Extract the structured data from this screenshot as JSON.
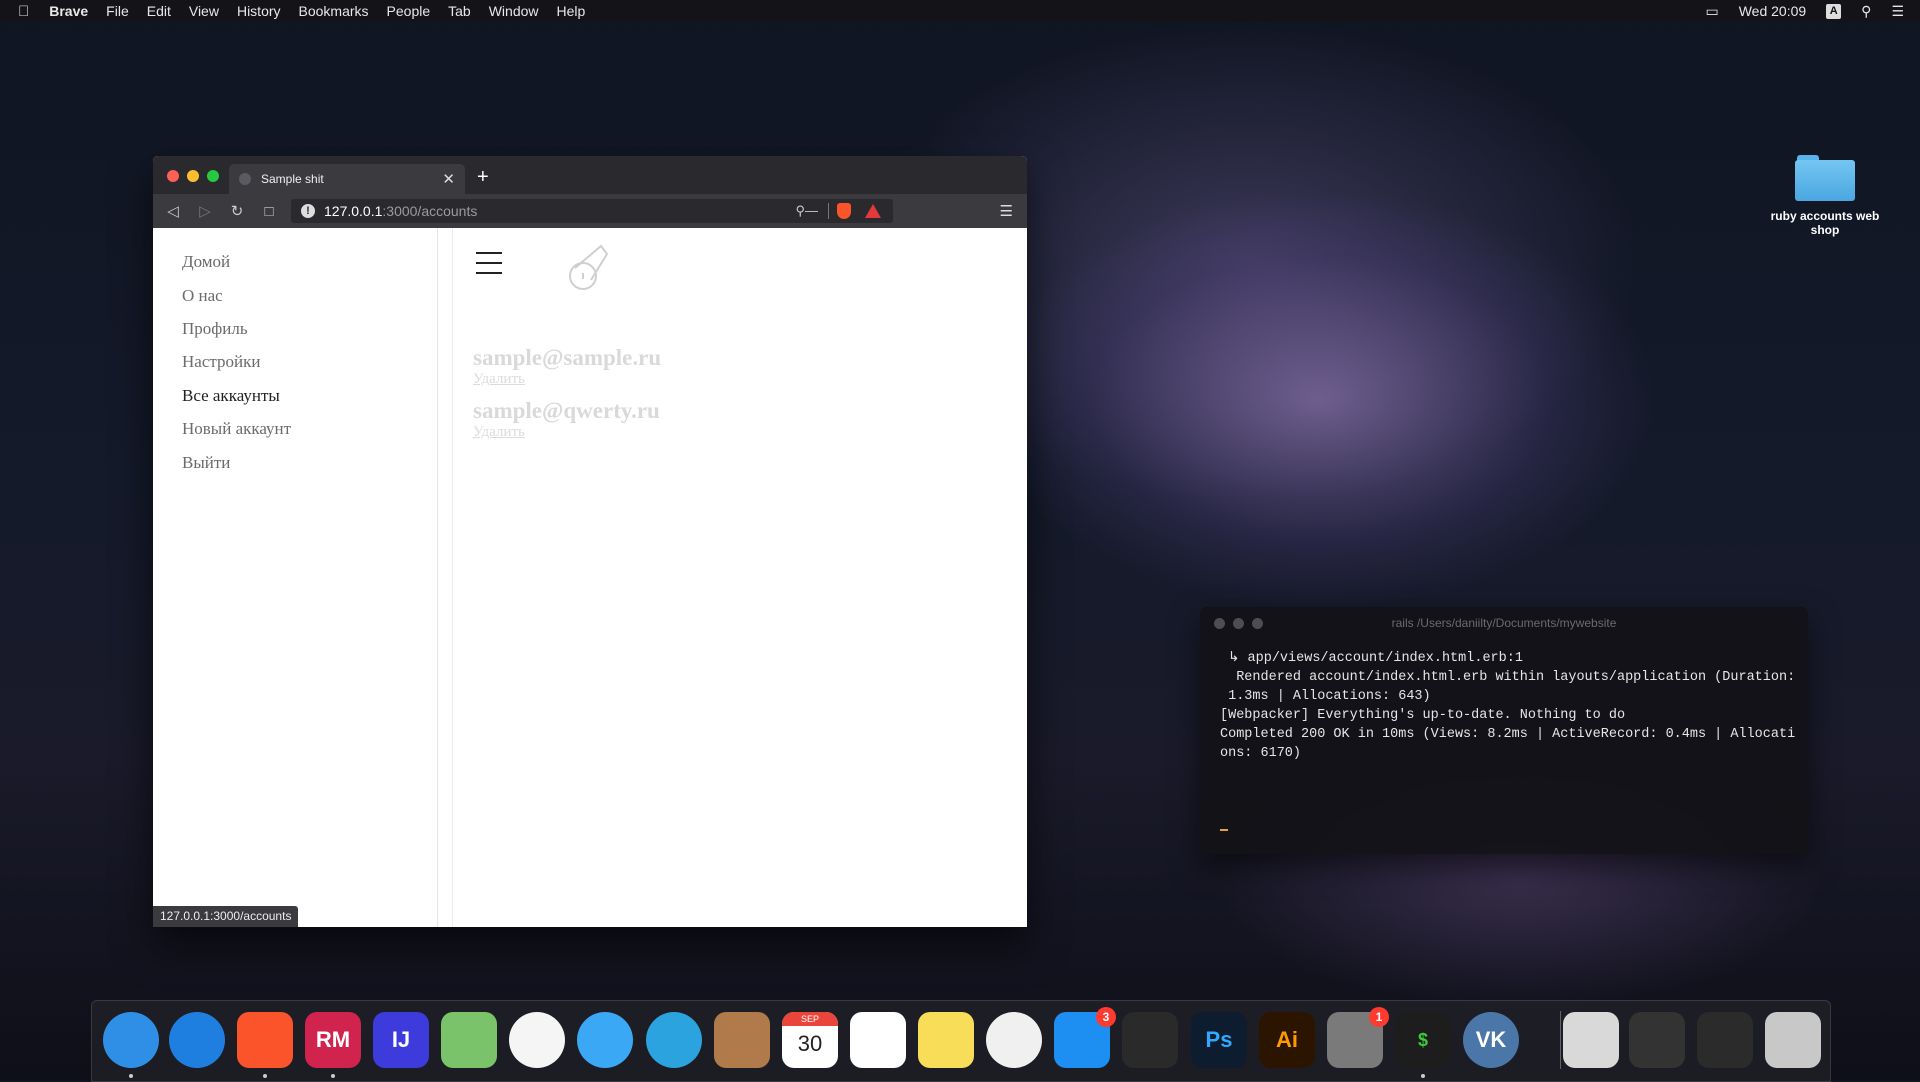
{
  "menubar": {
    "app": "Brave",
    "items": [
      "File",
      "Edit",
      "View",
      "History",
      "Bookmarks",
      "People",
      "Tab",
      "Window",
      "Help"
    ],
    "clock": "Wed 20:09",
    "input_badge": "A"
  },
  "desktop": {
    "folder_label": "ruby accounts web shop"
  },
  "browser": {
    "tab_title": "Sample shit",
    "url_host": "127.0.0.1",
    "url_path": ":3000/accounts",
    "status_url": "127.0.0.1:3000/accounts"
  },
  "site": {
    "nav": [
      "Домой",
      "О нас",
      "Профиль",
      "Настройки",
      "Все аккаунты",
      "Новый аккаунт",
      "Выйти"
    ],
    "active_nav": "Все аккаунты",
    "accounts": [
      {
        "email": "sample@sample.ru",
        "delete_label": "Удалить"
      },
      {
        "email": "sample@qwerty.ru",
        "delete_label": "Удалить"
      }
    ]
  },
  "terminal": {
    "title": "rails /Users/daniilty/Documents/mywebsite",
    "lines": [
      " ↳ app/views/account/index.html.erb:1",
      "  Rendered account/index.html.erb within layouts/application (Duration:",
      " 1.3ms | Allocations: 643)",
      "[Webpacker] Everything's up-to-date. Nothing to do",
      "Completed 200 OK in 10ms (Views: 8.2ms | ActiveRecord: 0.4ms | Allocati",
      "ons: 6170)"
    ]
  },
  "dock": {
    "apps": [
      {
        "name": "finder-icon",
        "label": "",
        "color": "#2f8fe6",
        "running": true
      },
      {
        "name": "safari-icon",
        "label": "",
        "color": "#1e7fe0",
        "running": false
      },
      {
        "name": "brave-icon",
        "label": "",
        "color": "#fb542b",
        "running": true
      },
      {
        "name": "rubymine-icon",
        "label": "RM",
        "color": "#d0244f",
        "running": true
      },
      {
        "name": "intellij-icon",
        "label": "IJ",
        "color": "#3d3bdc",
        "running": false
      },
      {
        "name": "maps-icon",
        "label": "",
        "color": "#7ac36a",
        "running": false
      },
      {
        "name": "photos-icon",
        "label": "",
        "color": "#f5f5f5",
        "running": false
      },
      {
        "name": "messages-icon",
        "label": "",
        "color": "#3aa8f5",
        "running": false
      },
      {
        "name": "telegram-icon",
        "label": "",
        "color": "#2aa3de",
        "running": false
      },
      {
        "name": "contacts-icon",
        "label": "",
        "color": "#b07a4a",
        "running": false
      },
      {
        "name": "calendar-icon",
        "label": "30",
        "color": "#ffffff",
        "running": false
      },
      {
        "name": "reminders-icon",
        "label": "",
        "color": "#ffffff",
        "running": false
      },
      {
        "name": "notes-icon",
        "label": "",
        "color": "#f7dd58",
        "running": false
      },
      {
        "name": "itunes-icon",
        "label": "",
        "color": "#f0f0f0",
        "running": false
      },
      {
        "name": "appstore-icon",
        "label": "",
        "color": "#1d8ef2",
        "running": false,
        "badge": "3"
      },
      {
        "name": "finalcut-icon",
        "label": "",
        "color": "#2a2a2a",
        "running": false
      },
      {
        "name": "photoshop-icon",
        "label": "Ps",
        "color": "#0e1c2f",
        "running": false
      },
      {
        "name": "illustrator-icon",
        "label": "Ai",
        "color": "#2b1400",
        "running": false
      },
      {
        "name": "system-preferences-icon",
        "label": "",
        "color": "#7a7a7a",
        "running": false,
        "badge": "1"
      },
      {
        "name": "terminal-icon",
        "label": "$",
        "color": "#1d1d1d",
        "running": true
      },
      {
        "name": "vk-icon",
        "label": "VK",
        "color": "#4a76a8",
        "running": false
      },
      {
        "name": "downloads-icon",
        "label": "",
        "color": "#d9d9d9",
        "running": false
      },
      {
        "name": "window-thumb-icon",
        "label": "",
        "color": "#333333",
        "running": false
      },
      {
        "name": "rubymine-window-thumb-icon",
        "label": "",
        "color": "#2b2b2b",
        "running": false
      },
      {
        "name": "trash-icon",
        "label": "",
        "color": "#c8c8c8",
        "running": false
      }
    ],
    "calendar_month": "SEP"
  }
}
